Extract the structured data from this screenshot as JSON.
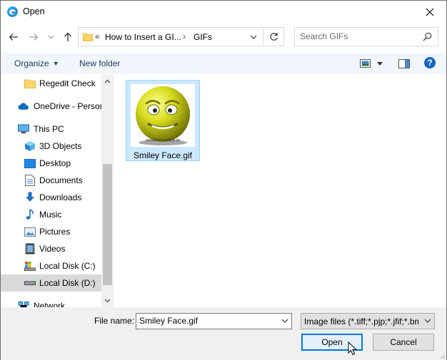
{
  "window": {
    "title": "Open",
    "app_icon": "edge-browser-icon"
  },
  "address": {
    "overflow_chevron": "«",
    "crumbs": [
      "How to Insert a GI...",
      "GIFs"
    ],
    "separator": "›"
  },
  "search": {
    "placeholder": "Search GIFs",
    "value": ""
  },
  "commands": {
    "organize_label": "Organize",
    "new_folder_label": "New folder"
  },
  "nav": {
    "items": [
      {
        "label": "Regedit Check",
        "icon": "folder-icon",
        "selected": false
      },
      {
        "label": "OneDrive - Personal",
        "icon": "onedrive-cloud-icon",
        "selected": false
      },
      {
        "label": "This PC",
        "icon": "this-pc-icon",
        "selected": false
      },
      {
        "label": "3D Objects",
        "icon": "3d-objects-icon",
        "selected": false
      },
      {
        "label": "Desktop",
        "icon": "desktop-icon",
        "selected": false
      },
      {
        "label": "Documents",
        "icon": "documents-icon",
        "selected": false
      },
      {
        "label": "Downloads",
        "icon": "downloads-icon",
        "selected": false
      },
      {
        "label": "Music",
        "icon": "music-icon",
        "selected": false
      },
      {
        "label": "Pictures",
        "icon": "pictures-icon",
        "selected": false
      },
      {
        "label": "Videos",
        "icon": "videos-icon",
        "selected": false
      },
      {
        "label": "Local Disk (C:)",
        "icon": "drive-c-icon",
        "selected": false
      },
      {
        "label": "Local Disk (D:)",
        "icon": "drive-d-icon",
        "selected": true
      },
      {
        "label": "Network",
        "icon": "network-icon",
        "selected": false
      }
    ]
  },
  "files": [
    {
      "name": "Smiley Face.gif",
      "selected": true,
      "thumb_caption": "www.fresh-smileys.de"
    }
  ],
  "bottom": {
    "file_name_label": "File name:",
    "file_name_value": "Smiley Face.gif",
    "file_type": "Image files (*.tiff;*.pjp;*.jfif;*.bmp;*.gif;*.svg;*.png;*.xbm;*.dib;*.jxl;*.jpeg;*.svgz;*.jpg;*.webp;*.ico;*.tif;*.pjpeg;*.avif)",
    "open_label": "Open",
    "cancel_label": "Cancel"
  },
  "colors": {
    "accent": "#0078d7",
    "selection": "#cce8ff",
    "command_bar": "#f0f6fb",
    "help": "#1565c0",
    "smiley": "#d8dc1c"
  }
}
